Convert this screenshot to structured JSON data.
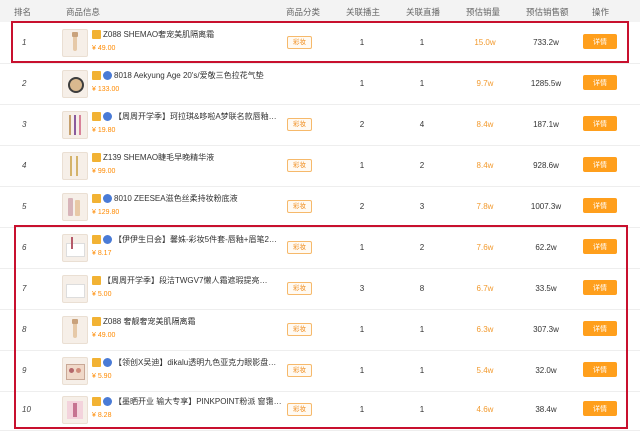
{
  "header": {
    "rank": "排名",
    "product": "商品信息",
    "category": "商品分类",
    "hosts": "关联播主",
    "lives": "关联直播",
    "est_sales": "预估销量",
    "est_amount": "预估销售额",
    "action": "操作"
  },
  "rows": [
    {
      "rank": "1",
      "title": "Z088 SHEMAO奢宠美肌隔离霜",
      "price": "¥ 49.00",
      "category": "彩妆",
      "hosts": "1",
      "lives": "1",
      "sales": "15.0w",
      "amount": "733.2w",
      "action": "详情"
    },
    {
      "rank": "2",
      "title": "8018 Aekyung Age 20's/爱敬三色拉花气垫",
      "price": "¥ 133.00",
      "category": "",
      "hosts": "1",
      "lives": "1",
      "sales": "9.7w",
      "amount": "1285.5w",
      "action": "详情"
    },
    {
      "rank": "3",
      "title": "【周周开学季】珂拉琪&哆啦A梦联名款唇釉泡…",
      "price": "¥ 19.80",
      "category": "彩妆",
      "hosts": "2",
      "lives": "4",
      "sales": "8.4w",
      "amount": "187.1w",
      "action": "详情"
    },
    {
      "rank": "4",
      "title": "Z139 SHEMAO睫毛早晚精华液",
      "price": "¥ 99.00",
      "category": "彩妆",
      "hosts": "1",
      "lives": "2",
      "sales": "8.4w",
      "amount": "928.6w",
      "action": "详情"
    },
    {
      "rank": "5",
      "title": "8010 ZEESEA滋色丝柔持妆粉底液",
      "price": "¥ 129.80",
      "category": "彩妆",
      "hosts": "2",
      "lives": "3",
      "sales": "7.8w",
      "amount": "1007.3w",
      "action": "详情"
    },
    {
      "rank": "6",
      "title": "【伊伊生日会】馨姝-彩妆5件套-唇釉+眉笔2支+…",
      "price": "¥ 8.17",
      "category": "彩妆",
      "hosts": "1",
      "lives": "2",
      "sales": "7.6w",
      "amount": "62.2w",
      "action": "详情"
    },
    {
      "rank": "7",
      "title": "【周周开学季】段洁TWGV7懒人霜遮瑕提亮素颜霜",
      "price": "¥ 5.00",
      "category": "彩妆",
      "hosts": "3",
      "lives": "8",
      "sales": "6.7w",
      "amount": "33.5w",
      "action": "详情"
    },
    {
      "rank": "8",
      "title": "Z088 奢靓奢宠美肌隔离霜",
      "price": "¥ 49.00",
      "category": "彩妆",
      "hosts": "1",
      "lives": "1",
      "sales": "6.3w",
      "amount": "307.3w",
      "action": "详情"
    },
    {
      "rank": "9",
      "title": "【领创X吴迪】dikalu透明九色亚克力眼影盘线光…",
      "price": "¥ 5.90",
      "category": "彩妆",
      "hosts": "1",
      "lives": "1",
      "sales": "5.4w",
      "amount": "32.0w",
      "action": "详情"
    },
    {
      "rank": "10",
      "title": "【墨晒开业 输大专享】PINKPOINT粉派 窗霭沉梦…",
      "price": "¥ 8.28",
      "category": "彩妆",
      "hosts": "1",
      "lives": "1",
      "sales": "4.6w",
      "amount": "38.4w",
      "action": "详情"
    }
  ],
  "colors": {
    "accent": "#ff9f1c",
    "highlight": "#c8102e",
    "price": "#ff8a00"
  }
}
